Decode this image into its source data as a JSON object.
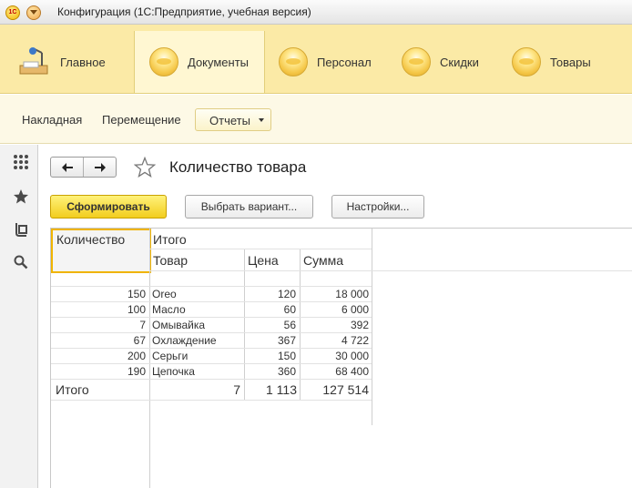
{
  "window": {
    "app_logo_text": "1C",
    "title": "Конфигурация  (1С:Предприятие, учебная версия)"
  },
  "sections": [
    {
      "label": "Главное",
      "icon": "desk-lamp-icon"
    },
    {
      "label": "Документы",
      "icon": "section-ball-icon",
      "active": true
    },
    {
      "label": "Персонал",
      "icon": "section-ball-icon"
    },
    {
      "label": "Скидки",
      "icon": "section-ball-icon"
    },
    {
      "label": "Товары",
      "icon": "section-ball-icon"
    }
  ],
  "commands": {
    "items": [
      "Накладная",
      "Перемещение"
    ],
    "reports_label": "Отчеты"
  },
  "left_panel": {
    "icons": [
      "apps-grid-icon",
      "favorites-star-icon",
      "history-icon",
      "search-icon"
    ]
  },
  "form": {
    "title": "Количество товара",
    "generate_button": "Сформировать",
    "variant_button": "Выбрать вариант...",
    "settings_button": "Настройки..."
  },
  "report": {
    "row_header": "Количество",
    "group_header": "Итого",
    "columns": [
      "Товар",
      "Цена",
      "Сумма"
    ],
    "rows": [
      {
        "qty": "150",
        "product": "Oreo",
        "price": "120",
        "sum": "18 000"
      },
      {
        "qty": "100",
        "product": "Масло",
        "price": "60",
        "sum": "6 000"
      },
      {
        "qty": "7",
        "product": "Омывайка",
        "price": "56",
        "sum": "392"
      },
      {
        "qty": "67",
        "product": "Охлаждение",
        "price": "367",
        "sum": "4 722"
      },
      {
        "qty": "200",
        "product": "Серьги",
        "price": "150",
        "sum": "30 000"
      },
      {
        "qty": "190",
        "product": "Цепочка",
        "price": "360",
        "sum": "68 400"
      }
    ],
    "total": {
      "label": "Итого",
      "product": "7",
      "price": "1 113",
      "sum": "127 514"
    }
  },
  "colors": {
    "sections_bg": "#fbeaa6",
    "active_section_bg": "#fff7d2",
    "commands_bg": "#fdf9e6",
    "primary_button": "#f2cd1e",
    "selection_border": "#f0b400"
  }
}
